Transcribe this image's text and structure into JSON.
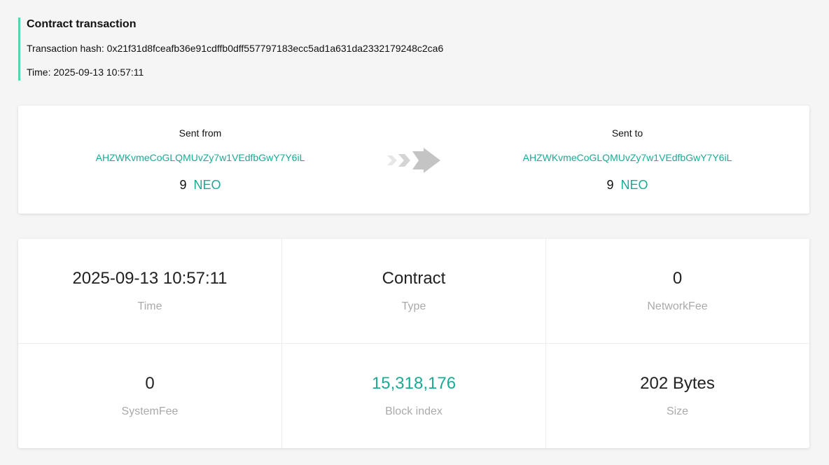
{
  "header": {
    "title": "Contract transaction",
    "hash_line": "Transaction hash: 0x21f31d8fceafb36e91cdffb0dff557797183ecc5ad1a631da2332179248c2ca6",
    "time_line": "Time: 2025-09-13 10:57:11",
    "accent_color": "#4fd8b0"
  },
  "transfer": {
    "from": {
      "label": "Sent from",
      "address": "AHZWKvmeCoGLQMUvZy7w1VEdfbGwY7Y6iL",
      "amount": "9",
      "asset": "NEO"
    },
    "to": {
      "label": "Sent to",
      "address": "AHZWKvmeCoGLQMUvZy7w1VEdfbGwY7Y6iL",
      "amount": "9",
      "asset": "NEO"
    },
    "arrow_icon": "triple-chevron-right-icon",
    "link_color": "#1aab94"
  },
  "stats": [
    {
      "value": "2025-09-13 10:57:11",
      "label": "Time"
    },
    {
      "value": "Contract",
      "label": "Type"
    },
    {
      "value": "0",
      "label": "NetworkFee"
    },
    {
      "value": "0",
      "label": "SystemFee"
    },
    {
      "value": "15,318,176",
      "label": "Block index"
    },
    {
      "value": "202 Bytes",
      "label": "Size"
    }
  ]
}
